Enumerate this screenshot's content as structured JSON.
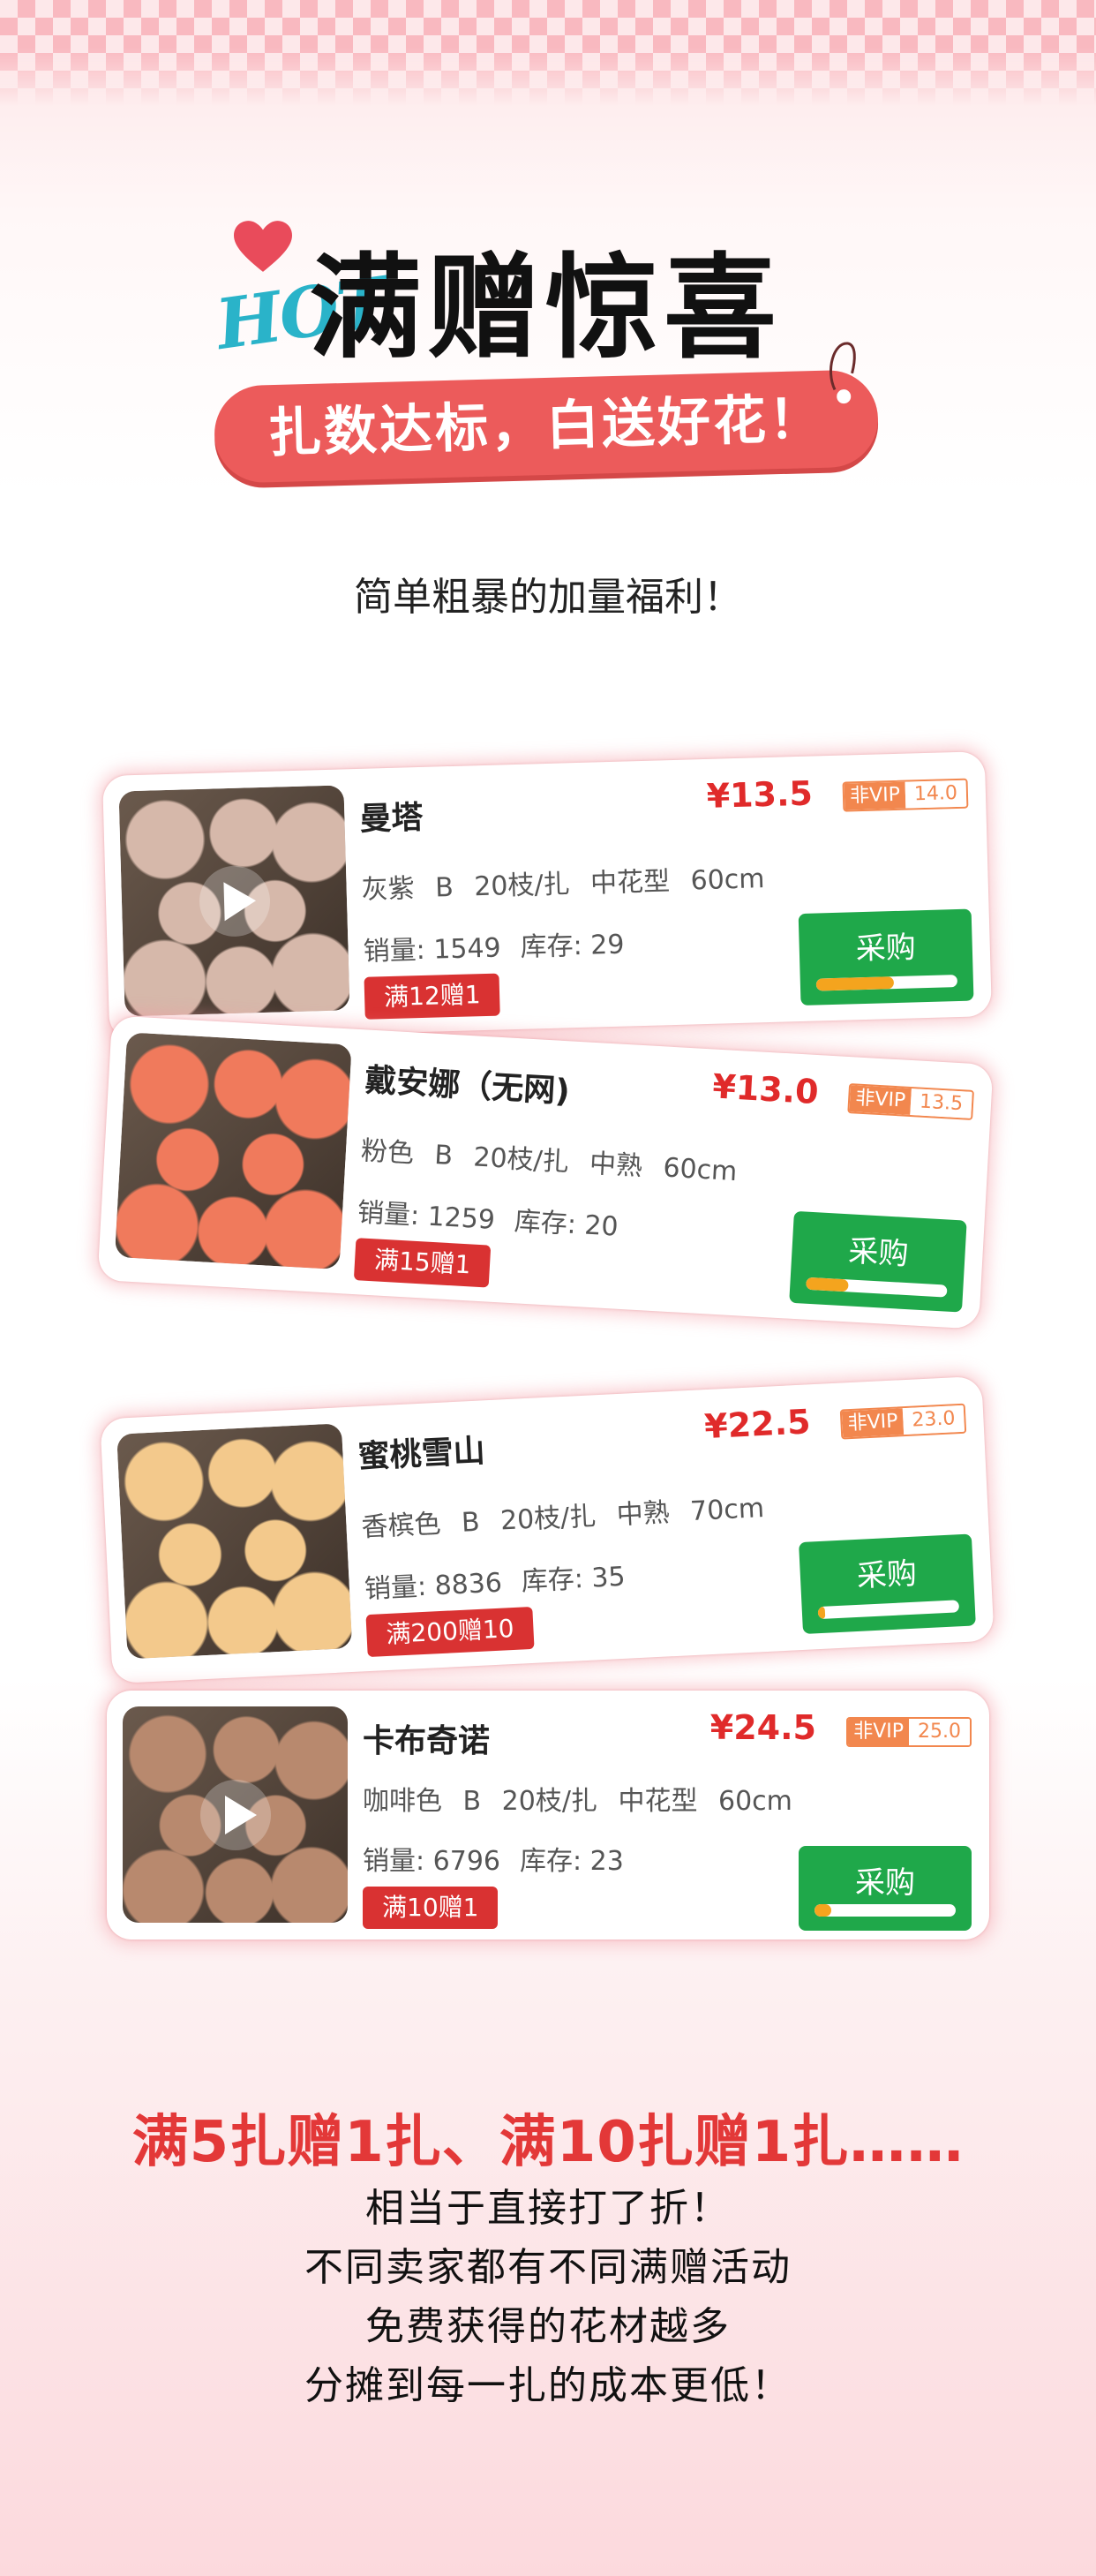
{
  "header": {
    "hot_text": "HOT",
    "title": "满赠惊喜",
    "pill_text": "扎数达标，白送好花！",
    "subtitle": "简单粗暴的加量福利！"
  },
  "products": [
    {
      "name": "曼塔",
      "price": "¥13.5",
      "vip_label": "非VIP",
      "vip_price": "14.0",
      "spec": "灰紫 B 20枝/扎 中花型 60cm",
      "sales": "销量: 1549",
      "stock": "库存: 29",
      "promo": "满12赠1",
      "buy_label": "采购",
      "progress": 0.55,
      "has_video": true,
      "flower_color": "#d6b8aa"
    },
    {
      "name": "戴安娜（无网)",
      "price": "¥13.0",
      "vip_label": "非VIP",
      "vip_price": "13.5",
      "spec": "粉色 B 20枝/扎 中熟 60cm",
      "sales": "销量: 1259",
      "stock": "库存: 20",
      "promo": "满15赠1",
      "buy_label": "采购",
      "progress": 0.3,
      "has_video": false,
      "flower_color": "#f07a5c"
    },
    {
      "name": "蜜桃雪山",
      "price": "¥22.5",
      "vip_label": "非VIP",
      "vip_price": "23.0",
      "spec": "香槟色 B 20枝/扎 中熟 70cm",
      "sales": "销量: 8836",
      "stock": "库存: 35",
      "promo": "满200赠10",
      "buy_label": "采购",
      "progress": 0.05,
      "has_video": false,
      "flower_color": "#f3c98c"
    },
    {
      "name": "卡布奇诺",
      "price": "¥24.5",
      "vip_label": "非VIP",
      "vip_price": "25.0",
      "spec": "咖啡色 B 20枝/扎 中花型 60cm",
      "sales": "销量: 6796",
      "stock": "库存: 23",
      "promo": "满10赠1",
      "buy_label": "采购",
      "progress": 0.12,
      "has_video": true,
      "flower_color": "#b8896e"
    }
  ],
  "footer": {
    "tagline": "满5扎赠1扎、满10扎赠1扎……",
    "lines": [
      "相当于直接打了折！",
      "不同卖家都有不同满赠活动",
      "免费获得的花材越多",
      "分摊到每一扎的成本更低！"
    ]
  },
  "colors": {
    "accent_red": "#e33838",
    "pill_red": "#ec5b5b",
    "buy_green": "#1fa84a",
    "vip_orange": "#f2874e",
    "hot_blue": "#2ab3c9"
  }
}
